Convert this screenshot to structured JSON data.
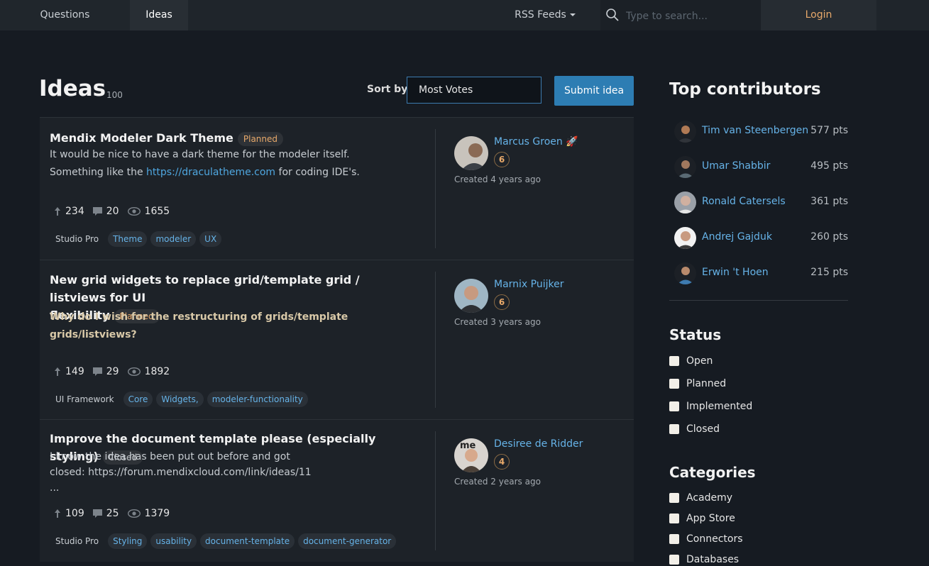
{
  "nav": {
    "questions": "Questions",
    "ideas": "Ideas",
    "rss": "RSS Feeds",
    "search_placeholder": "Type to search...",
    "login": "Login"
  },
  "header": {
    "title": "Ideas",
    "count": "100",
    "sort_label": "Sort by",
    "sort_value": "Most Votes",
    "submit": "Submit idea"
  },
  "ideas": [
    {
      "title": "Mendix Modeler Dark Theme",
      "status": "Planned",
      "desc_line1": "It would be nice to have a dark theme for the modeler itself.",
      "desc_line2_pre": "Something like the ",
      "desc_link": "https://draculatheme.com",
      "desc_line2_post": " for coding IDE's.",
      "votes": "234",
      "comments": "20",
      "views": "1655",
      "category": "Studio Pro",
      "tags": [
        "Theme",
        "modeler",
        "UX"
      ],
      "author": "Marcus Groen",
      "rank": "6",
      "created": "Created 4 years ago"
    },
    {
      "title_line1": "New grid widgets to replace grid/template grid / listviews for UI",
      "title_line2": "flexibility",
      "status": "Planned",
      "desc": "Why do I wish for the restructuring of grids/template grids/listviews?",
      "votes": "149",
      "comments": "29",
      "views": "1892",
      "category": "UI Framework",
      "tags": [
        "Core",
        "Widgets,",
        "modeler-functionality"
      ],
      "author": "Marnix Puijker",
      "rank": "6",
      "created": "Created 3 years ago"
    },
    {
      "title": "Improve the document template please (especially styling)",
      "status": "Closed",
      "desc_line1": "I know the idea has been put out before and got",
      "desc_line2": "closed: https://forum.mendixcloud.com/link/ideas/11",
      "desc_line3": "...",
      "votes": "109",
      "comments": "25",
      "views": "1379",
      "category": "Studio Pro",
      "tags": [
        "Styling",
        "usability",
        "document-template",
        "document-generator"
      ],
      "author": "Desiree de Ridder",
      "rank": "4",
      "created": "Created 2 years ago"
    }
  ],
  "sidebar": {
    "contributors_title": "Top contributors",
    "contributors": [
      {
        "name": "Tim van Steenbergen",
        "pts": "577 pts"
      },
      {
        "name": "Umar Shabbir",
        "pts": "495 pts"
      },
      {
        "name": "Ronald Catersels",
        "pts": "361 pts"
      },
      {
        "name": "Andrej Gajduk",
        "pts": "260 pts"
      },
      {
        "name": "Erwin 't Hoen",
        "pts": "215 pts"
      }
    ],
    "status_title": "Status",
    "status_options": [
      "Open",
      "Planned",
      "Implemented",
      "Closed"
    ],
    "categories_title": "Categories",
    "category_options": [
      "Academy",
      "App Store",
      "Connectors",
      "Databases"
    ]
  },
  "colors": {
    "background": "#161b22",
    "card": "#1d2228",
    "link": "#66b3e8",
    "accent_orange": "#e8a96a",
    "primary_button": "#2d7db3"
  }
}
